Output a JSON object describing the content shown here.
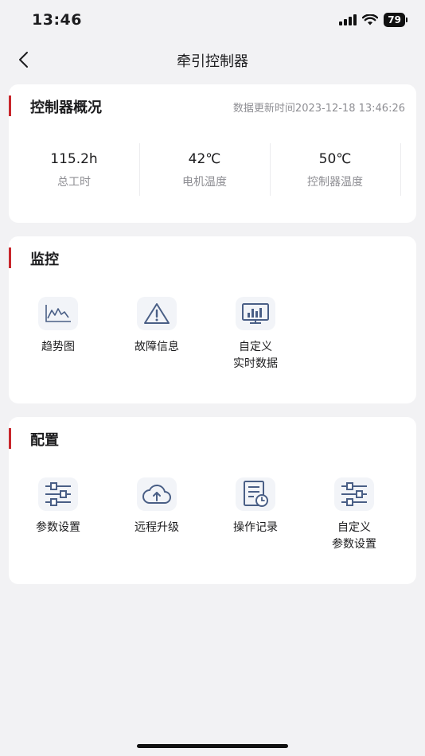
{
  "status_bar": {
    "time": "13:46",
    "battery": "79"
  },
  "nav": {
    "title": "牵引控制器"
  },
  "overview": {
    "title": "控制器概况",
    "update_time": "数据更新时间2023-12-18 13:46:26",
    "stats": [
      {
        "value": "115.2h",
        "label": "总工时"
      },
      {
        "value": "42℃",
        "label": "电机温度"
      },
      {
        "value": "50℃",
        "label": "控制器温度"
      }
    ]
  },
  "monitor": {
    "title": "监控",
    "items": [
      {
        "label": "趋势图",
        "icon": "trend-chart-icon"
      },
      {
        "label": "故障信息",
        "icon": "warning-triangle-icon"
      },
      {
        "label": "自定义\n实时数据",
        "icon": "realtime-data-icon"
      }
    ]
  },
  "config": {
    "title": "配置",
    "items": [
      {
        "label": "参数设置",
        "icon": "sliders-icon"
      },
      {
        "label": "远程升级",
        "icon": "cloud-upload-icon"
      },
      {
        "label": "操作记录",
        "icon": "record-log-icon"
      },
      {
        "label": "自定义\n参数设置",
        "icon": "sliders-icon"
      }
    ]
  },
  "colors": {
    "accent": "#c8262c",
    "icon": "#4a5f86",
    "icon_bg": "#f2f4f8"
  }
}
